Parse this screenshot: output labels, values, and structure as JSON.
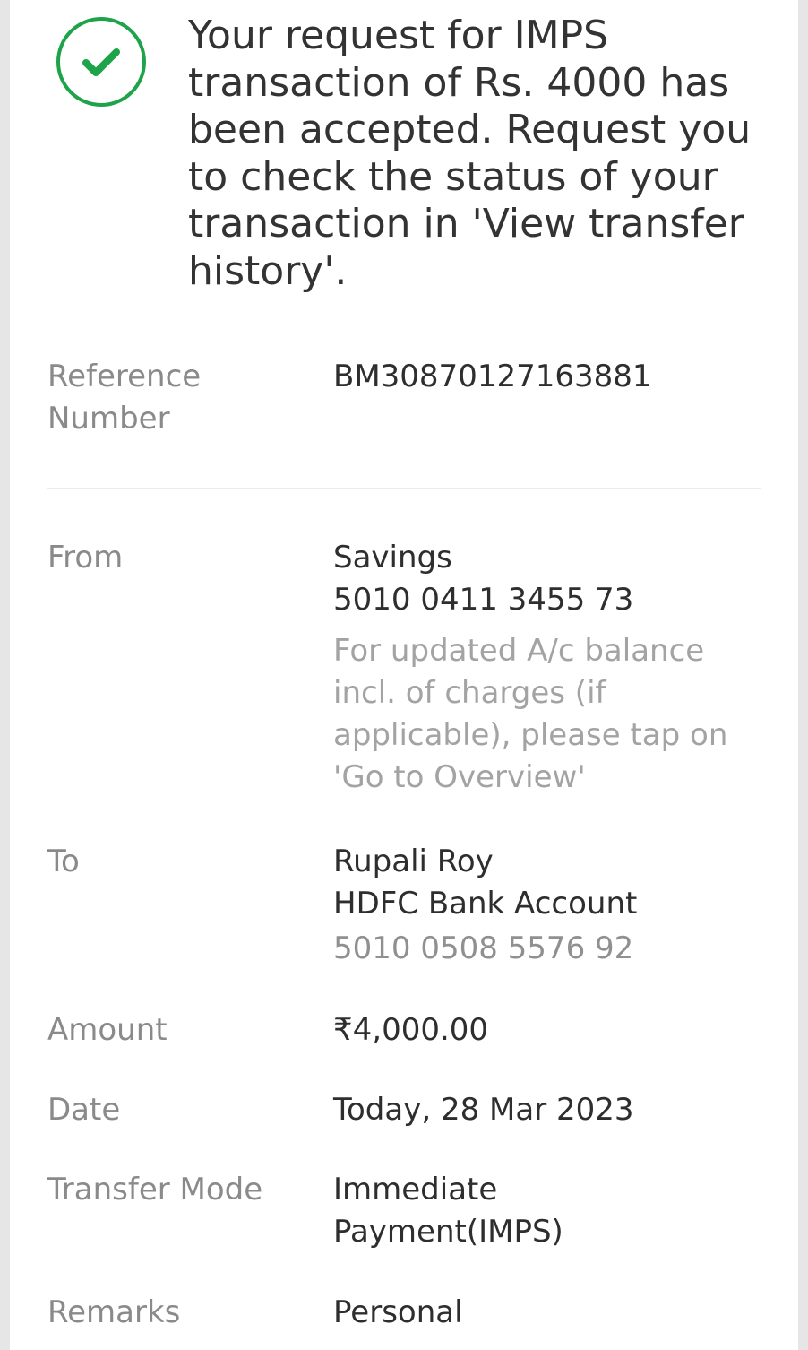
{
  "colors": {
    "success": "#1fa34a",
    "text": "#2e2e2e",
    "label": "#8a8a8a"
  },
  "status": {
    "icon": "check-circle-icon",
    "message": "Your request for IMPS transaction of Rs. 4000 has been accepted. Request you to check the status of your transaction in 'View transfer history'."
  },
  "details": {
    "reference": {
      "label": "Reference Number",
      "value": "BM30870127163881"
    },
    "from": {
      "label": "From",
      "account_type": "Savings",
      "account_number": "5010 0411 3455 73",
      "note": "For updated A/c balance incl. of charges (if applicable), please tap on 'Go to Overview'"
    },
    "to": {
      "label": "To",
      "name": "Rupali Roy",
      "bank": "HDFC Bank Account",
      "account_number": "5010 0508 5576 92"
    },
    "amount": {
      "label": "Amount",
      "value": "₹4,000.00"
    },
    "date": {
      "label": "Date",
      "value": "Today, 28 Mar 2023"
    },
    "transfer_mode": {
      "label": "Transfer Mode",
      "value": "Immediate Payment(IMPS)"
    },
    "remarks": {
      "label": "Remarks",
      "value": "Personal"
    }
  }
}
